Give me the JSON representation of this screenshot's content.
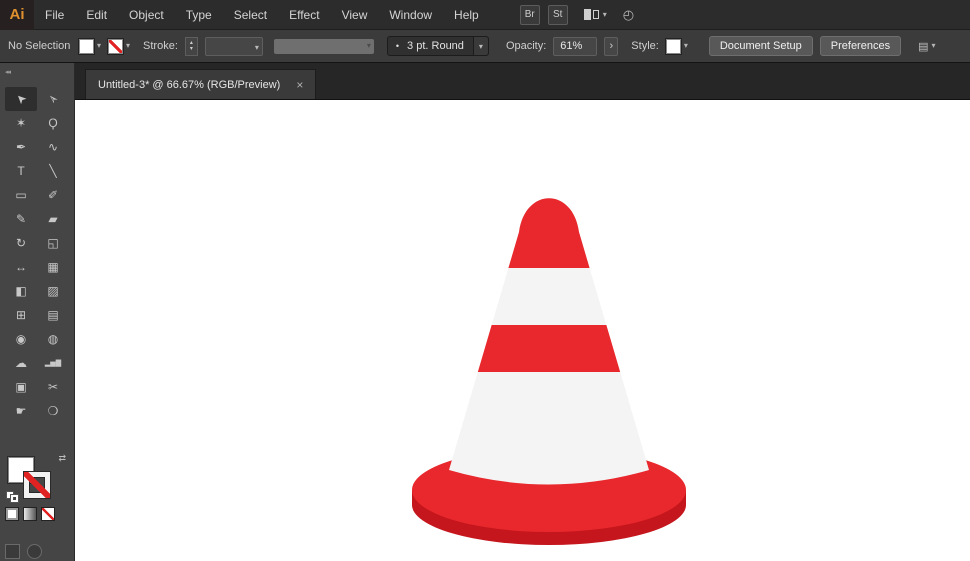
{
  "menubar": {
    "logo_text": "Ai",
    "items": [
      "File",
      "Edit",
      "Object",
      "Type",
      "Select",
      "Effect",
      "View",
      "Window",
      "Help"
    ],
    "bridge_button": "Br",
    "stock_button": "St"
  },
  "control_bar": {
    "selection_status": "No Selection",
    "stroke_label": "Stroke:",
    "brush_bullet": "•",
    "brush_name": "3 pt. Round",
    "opacity_label": "Opacity:",
    "opacity_value": "61%",
    "style_label": "Style:",
    "document_setup_button": "Document Setup",
    "preferences_button": "Preferences"
  },
  "tab_bar": {
    "tab_title": "Untitled-3* @ 66.67% (RGB/Preview)",
    "tab_close": "×"
  },
  "toolbar": {
    "tools": [
      {
        "name": "selection-tool",
        "glyph": "➤",
        "rot": -135,
        "selected": true
      },
      {
        "name": "direct-selection-tool",
        "glyph": "➢",
        "rot": -135
      },
      {
        "name": "magic-wand-tool",
        "glyph": "✶"
      },
      {
        "name": "lasso-tool",
        "glyph": "Ϙ"
      },
      {
        "name": "pen-tool",
        "glyph": "✒"
      },
      {
        "name": "curvature-tool",
        "glyph": "∿"
      },
      {
        "name": "type-tool",
        "glyph": "T"
      },
      {
        "name": "line-segment-tool",
        "glyph": "╲"
      },
      {
        "name": "rectangle-tool",
        "glyph": "▭"
      },
      {
        "name": "paintbrush-tool",
        "glyph": "✐"
      },
      {
        "name": "pencil-tool",
        "glyph": "✎"
      },
      {
        "name": "eraser-tool",
        "glyph": "▰"
      },
      {
        "name": "rotate-tool",
        "glyph": "↻"
      },
      {
        "name": "scale-tool",
        "glyph": "◱"
      },
      {
        "name": "width-tool",
        "glyph": "↔"
      },
      {
        "name": "free-transform-tool",
        "glyph": "▦"
      },
      {
        "name": "shape-builder-tool",
        "glyph": "◧"
      },
      {
        "name": "perspective-grid-tool",
        "glyph": "▨"
      },
      {
        "name": "mesh-tool",
        "glyph": "⊞"
      },
      {
        "name": "gradient-tool",
        "glyph": "▤"
      },
      {
        "name": "eyedropper-tool",
        "glyph": "◉"
      },
      {
        "name": "blend-tool",
        "glyph": "◍"
      },
      {
        "name": "symbol-sprayer-tool",
        "glyph": "☁"
      },
      {
        "name": "column-graph-tool",
        "glyph": "▂▅▇",
        "size": 7
      },
      {
        "name": "artboard-tool",
        "glyph": "▣"
      },
      {
        "name": "slice-tool",
        "glyph": "✂"
      },
      {
        "name": "hand-tool",
        "glyph": "☛"
      },
      {
        "name": "zoom-tool",
        "glyph": "❍"
      }
    ]
  },
  "canvas": {
    "cone_colors": {
      "red": "#e8282c",
      "red_dark": "#c4161c",
      "stripe_white": "#f4f4f5"
    }
  },
  "icons": {
    "dropdown_chevron": "▾",
    "up_arrow": "▴",
    "forward_chevron": "›",
    "swap_arrows": "⇄",
    "collapse_arrows": "◂◂",
    "gauge": "◴",
    "panel_menu": "▤"
  }
}
